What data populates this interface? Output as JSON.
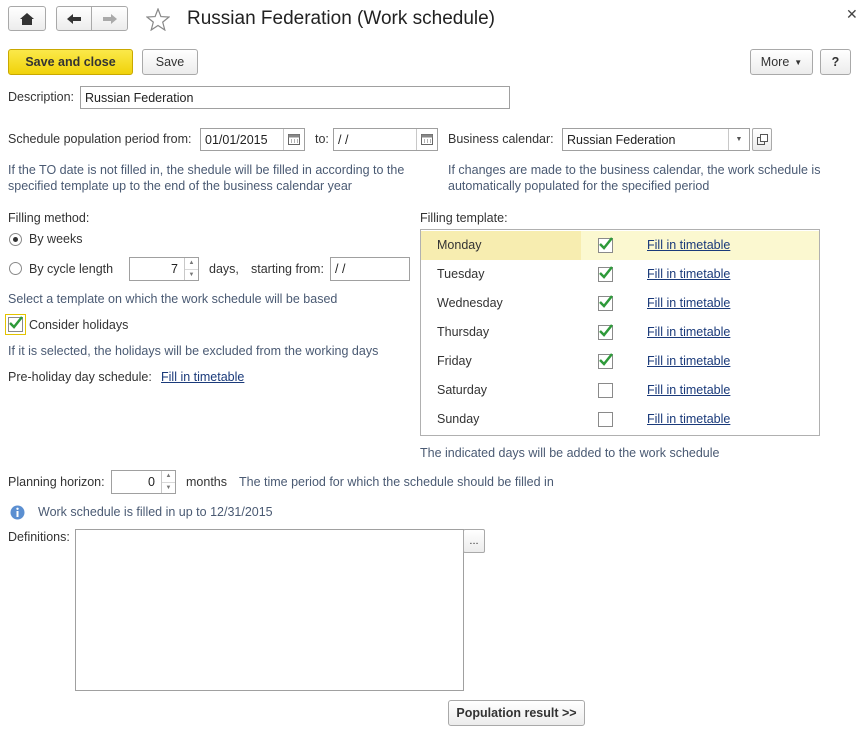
{
  "title": "Russian Federation (Work schedule)",
  "toolbar": {
    "save_close": "Save and close",
    "save": "Save",
    "more": "More",
    "help": "?"
  },
  "description": {
    "label": "Description:",
    "value": "Russian Federation"
  },
  "period": {
    "from_label": "Schedule population period from:",
    "from_value": "01/01/2015",
    "to_label": "to:",
    "to_value": " /  /",
    "hint": "If the TO date is not filled in, the shedule will be filled in according to the specified template up to the end of the business calendar year"
  },
  "business_calendar": {
    "label": "Business calendar:",
    "value": "Russian Federation",
    "hint": "If changes are made to the business calendar, the work schedule is automatically populated for the specified period"
  },
  "filling_method": {
    "label": "Filling method:",
    "by_weeks": "By weeks",
    "by_cycle": "By cycle length",
    "cycle_value": "7",
    "days": "days,",
    "starting_from": "starting from:",
    "starting_value": " /  /",
    "hint": "Select a template on which the work schedule will be based"
  },
  "holidays": {
    "label": "Consider holidays",
    "hint": "If it is selected, the holidays will be excluded from the working days",
    "preholiday_label": "Pre-holiday day schedule:",
    "preholiday_link": "Fill in timetable"
  },
  "template": {
    "label": "Filling template:",
    "rows": [
      {
        "day": "Monday",
        "checked": true,
        "link": "Fill in timetable"
      },
      {
        "day": "Tuesday",
        "checked": true,
        "link": "Fill in timetable"
      },
      {
        "day": "Wednesday",
        "checked": true,
        "link": "Fill in timetable"
      },
      {
        "day": "Thursday",
        "checked": true,
        "link": "Fill in timetable"
      },
      {
        "day": "Friday",
        "checked": true,
        "link": "Fill in timetable"
      },
      {
        "day": "Saturday",
        "checked": false,
        "link": "Fill in timetable"
      },
      {
        "day": "Sunday",
        "checked": false,
        "link": "Fill in timetable"
      }
    ],
    "hint": "The indicated days will be added to the work schedule"
  },
  "planning": {
    "label": "Planning horizon:",
    "value": "0",
    "unit": "months",
    "hint": "The time period for which the schedule should be filled in"
  },
  "info": "Work schedule is filled in up to 12/31/2015",
  "definitions": {
    "label": "Definitions:",
    "button": "..."
  },
  "population_result": "Population result >>",
  "colors": {
    "accent_yellow": "#f5d90f",
    "check_green": "#2e9a3a",
    "selected_row": "#f7edb0"
  }
}
